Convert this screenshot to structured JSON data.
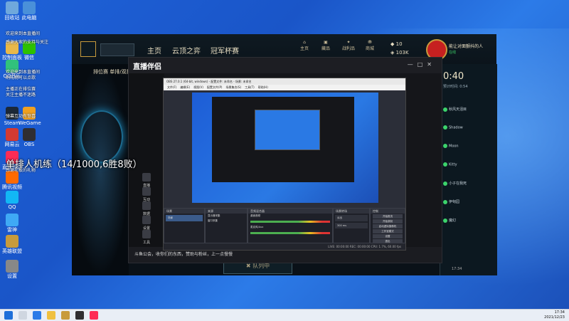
{
  "desktop": {
    "icons": [
      {
        "label": "回收站",
        "color": "#6fa8dc"
      },
      {
        "label": "此电脑",
        "color": "#4a90d9"
      },
      {
        "label": "控制面板",
        "color": "#e8b84a"
      },
      {
        "label": "微信",
        "color": "#2dc100"
      },
      {
        "label": "QQ音乐",
        "color": "#31c27c"
      },
      {
        "label": "Steam",
        "color": "#1b2838"
      },
      {
        "label": "WeGame",
        "color": "#f0a020"
      },
      {
        "label": "网易云",
        "color": "#d33a31"
      },
      {
        "label": "OBS",
        "color": "#302e31"
      },
      {
        "label": "直播伴侣",
        "color": "#fe2c55"
      },
      {
        "label": "腾讯视频",
        "color": "#ff6a00"
      },
      {
        "label": "QQ",
        "color": "#12b7f5"
      },
      {
        "label": "雷神",
        "color": "#3fa9f5"
      },
      {
        "label": "英雄联盟",
        "color": "#c89b3c"
      },
      {
        "label": "设置",
        "color": "#888888"
      }
    ],
    "overlay_lines": [
      "欢迎来到本直播间",
      "感谢大家的支持与关注",
      "欢迎来到本直播间",
      "刷礼物可以点歌",
      "主播正在排位赛",
      "关注主播不迷路",
      "弹幕互动有惊喜",
      "感谢老板的礼物"
    ],
    "caption": "单排人机练（14/1000,6胜8败）"
  },
  "lol": {
    "nav": [
      "主页",
      "云顶之弈",
      "冠军杯赛"
    ],
    "icons": [
      "主页",
      "藏品",
      "战利品",
      "商城"
    ],
    "currency_1": "10",
    "currency_2": "103K",
    "user_line_1": "能让对面颤抖的人",
    "user_line_2": "在线",
    "mode_title": "排位赛 单排/双排",
    "timer": "0:40",
    "timer_sub": "预计时间: 0:54",
    "friends": [
      "秋风天泪目",
      "Shadow",
      "Moon",
      "Kitty",
      "小子在我死",
      "伊甸园",
      "魔幻"
    ],
    "exit_label": "退出",
    "queue_button": "队列中",
    "tray_time": "17:34"
  },
  "live": {
    "title": "直播伴侣",
    "side_items": [
      "直播",
      "互动",
      "数据",
      "设置",
      "工具"
    ],
    "footer_text": "斗鱼公会，收你们的东西，赞助与粉丝，上一点慢慢"
  },
  "obs": {
    "title": "OBS 27.0.1 (64-bit, windows) - 配置文件: 未命名 - 场景: 未命名",
    "menu": [
      "文件(F)",
      "编辑(E)",
      "视图(V)",
      "配置文件(P)",
      "场景集合(S)",
      "工具(T)",
      "帮助(H)"
    ],
    "dock_scenes": "场景",
    "dock_sources": "来源",
    "dock_mixer": "音频混合器",
    "dock_transitions": "场景转场",
    "dock_controls": "控制",
    "scene_item": "场景",
    "source_items": [
      "显示器采集",
      "窗口采集"
    ],
    "mixer_items": [
      "桌面音频",
      "麦克风/Aux"
    ],
    "controls": [
      "开始推流",
      "开始录制",
      "启动虚拟摄像机",
      "工作室模式",
      "设置",
      "退出"
    ],
    "transition": "淡出",
    "duration": "300 ms",
    "status": "LIVE: 00:00:00   REC: 00:00:00   CPU: 1.7%, 60.00 fps"
  },
  "taskbar": {
    "time": "17:34",
    "date": "2021/12/23"
  }
}
